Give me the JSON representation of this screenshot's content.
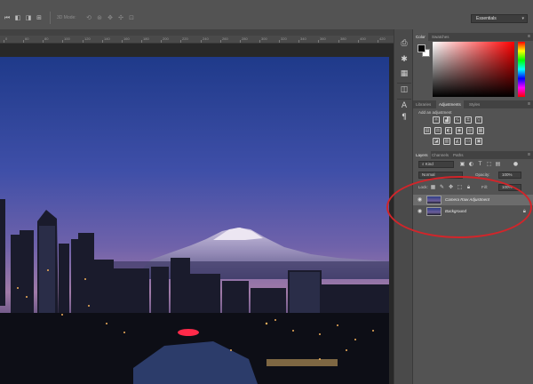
{
  "options_bar": {
    "zoom_label": "3D Mode:",
    "workspace_label": "Essentials"
  },
  "ruler": {
    "numbers": [
      "0",
      "60",
      "80",
      "100",
      "120",
      "140",
      "160",
      "180",
      "200",
      "220",
      "240",
      "260",
      "280",
      "300",
      "320",
      "340",
      "360",
      "380",
      "400",
      "420"
    ]
  },
  "color_panel": {
    "tabs": [
      "Color",
      "Swatches"
    ],
    "foreground_color": "#050505",
    "background_color": "#ffffff",
    "hue": "#ff0000"
  },
  "adjustments_panel": {
    "tabs": [
      "Libraries",
      "Adjustments",
      "Styles"
    ],
    "active_tab": "Adjustments",
    "title": "Add an adjustment"
  },
  "layers_panel": {
    "tabs": [
      "Layers",
      "Channels",
      "Paths"
    ],
    "filter_label": "Kind",
    "blend_mode": "Normal",
    "opacity_label": "Opacity:",
    "opacity_value": "100%",
    "lock_label": "Lock:",
    "fill_label": "Fill:",
    "fill_value": "100%",
    "layers": [
      {
        "name": "Camera Raw Adjustment",
        "selected": true,
        "locked": false
      },
      {
        "name": "Background",
        "selected": false,
        "locked": true
      }
    ]
  },
  "annotation_color": "#d2252a"
}
